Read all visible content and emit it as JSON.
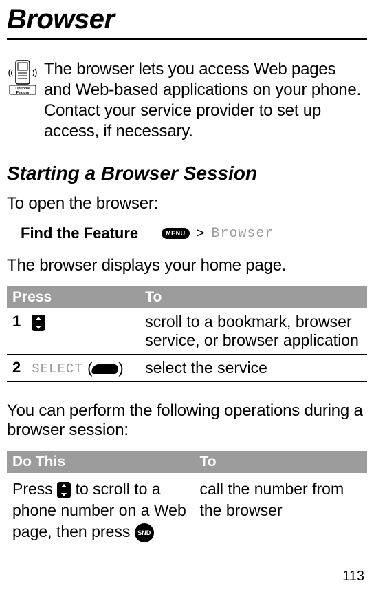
{
  "title": "Browser",
  "intro": "The browser lets you access Web pages and Web-based applications on your phone. Contact your service provider to set up access, if necessary.",
  "optional_feature_label": "Optional Feature",
  "section_heading": "Starting a Browser Session",
  "open_text": "To open the browser:",
  "find_feature_label": "Find the Feature",
  "menu_key_label": "MENU",
  "gt": ">",
  "breadcrumb": "Browser",
  "home_page_text": "The browser displays your home page.",
  "table1": {
    "headers": {
      "press": "Press",
      "to": "To"
    },
    "rows": [
      {
        "num": "1",
        "press_icon": "nav-key",
        "to": "scroll to a bookmark, browser service, or browser application"
      },
      {
        "num": "2",
        "select_label": "SELECT",
        "softkey_icon": "soft-key",
        "to": "select the service"
      }
    ]
  },
  "ops_intro": "You can perform the following operations during a browser session:",
  "table2": {
    "headers": {
      "do": "Do This",
      "to": "To"
    },
    "rows": [
      {
        "do_pre": "Press ",
        "nav_icon": "nav-key",
        "do_mid": " to scroll to a phone number on a Web page, then press ",
        "snd_label": "SND",
        "to": "call the number from the browser"
      }
    ]
  },
  "page_number": "113"
}
